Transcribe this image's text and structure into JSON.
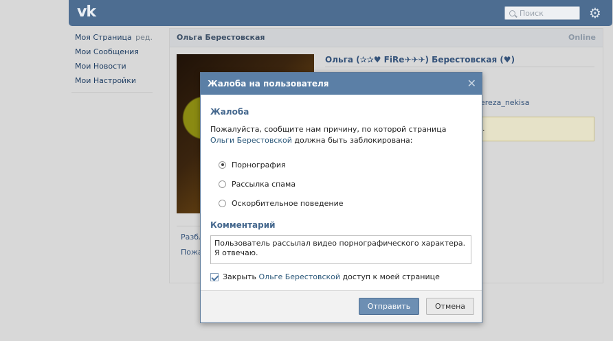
{
  "app": {
    "logo": "vk",
    "search_placeholder": "Поиск"
  },
  "left_menu": {
    "items": [
      {
        "label": "Моя Страница",
        "edit": "ред."
      },
      {
        "label": "Мои Сообщения"
      },
      {
        "label": "Мои Новости"
      },
      {
        "label": "Мои Настройки"
      }
    ]
  },
  "profile": {
    "header_name": "Ольга Берестовская",
    "status": "Online",
    "full_name": "Ольга (✰✰♥ FiRe✈✈✈) Берестовская (♥)",
    "side_link": "ereza_nekisa",
    "yellow_box_text": ".",
    "actions": [
      "Разбл",
      "Пожа"
    ]
  },
  "modal": {
    "title": "Жалоба на пользователя",
    "close_glyph": "✕",
    "section_title": "Жалоба",
    "desc_prefix": "Пожалуйста, сообщите нам причину, по которой страница ",
    "desc_link": "Ольги Берестовской",
    "desc_suffix": " должна быть заблокирована:",
    "reasons": [
      {
        "label": "Порнография",
        "checked": true
      },
      {
        "label": "Рассылка спама",
        "checked": false
      },
      {
        "label": "Оскорбительное поведение",
        "checked": false
      }
    ],
    "comment_title": "Комментарий",
    "comment_value": "Пользователь рассылал видео порнографического характера. Я отвечаю.",
    "block_prefix": "Закрыть ",
    "block_link": "Ольге Берестовской",
    "block_suffix": " доступ к моей странице",
    "block_checked": true,
    "send_label": "Отправить",
    "cancel_label": "Отмена"
  }
}
